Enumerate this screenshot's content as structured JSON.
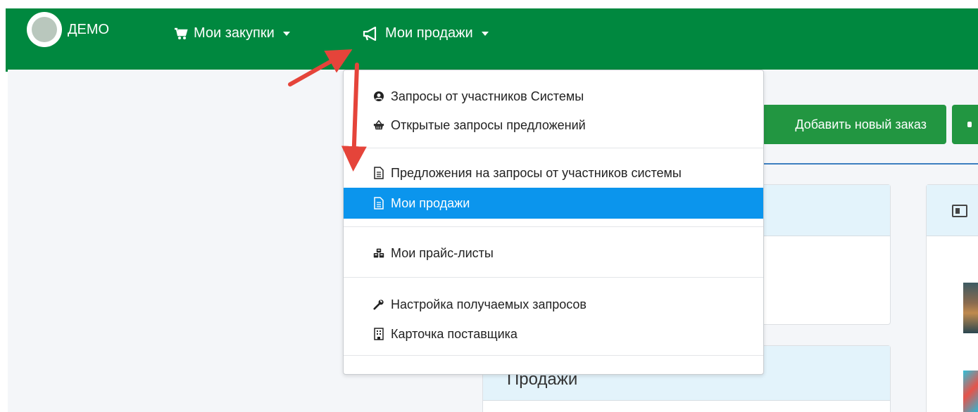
{
  "topbar": {
    "brand": "ДЕМО",
    "nav": [
      {
        "label": "Мои закупки",
        "icon": "cart-icon"
      },
      {
        "label": "Мои продажи",
        "icon": "bullhorn-icon"
      }
    ]
  },
  "dropdown": {
    "items": [
      {
        "label": "Запросы от участников Системы",
        "icon": "user-circle-icon"
      },
      {
        "label": "Открытые запросы предложений",
        "icon": "basket-icon"
      },
      {
        "label": "Предложения на запросы от участников системы",
        "icon": "document-icon"
      },
      {
        "label": "Мои продажи",
        "icon": "document-icon"
      },
      {
        "label": "Мои прайс-листы",
        "icon": "cubes-icon"
      },
      {
        "label": "Настройка получаемых запросов",
        "icon": "wrench-icon"
      },
      {
        "label": "Карточка поставщика",
        "icon": "building-icon"
      }
    ]
  },
  "main": {
    "add_order_button": "Добавить новый заказ",
    "sales_card_title": "Продажи"
  },
  "colors": {
    "topbar": "#00883f",
    "button": "#229641",
    "active_item": "#0b95ed",
    "card_header": "#e3f3fb",
    "annotation_arrow": "#e5443a"
  }
}
